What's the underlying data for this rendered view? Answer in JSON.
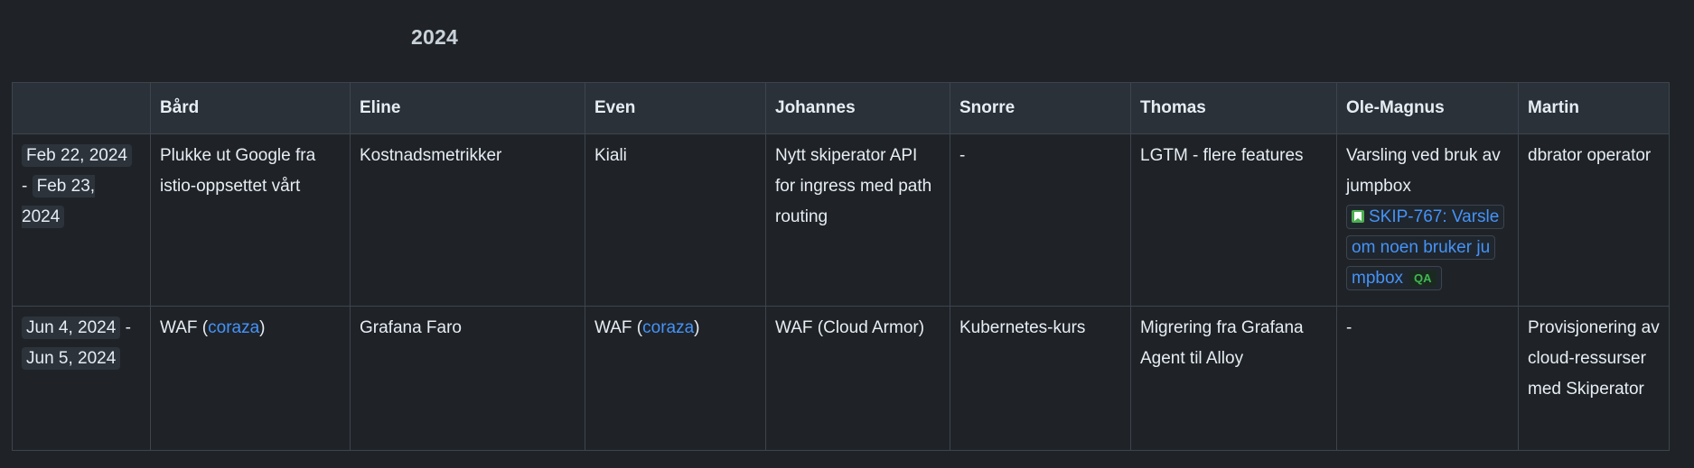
{
  "section_title": "2024",
  "table": {
    "headers": [
      "",
      "Bård",
      "Eline",
      "Even",
      "Johannes",
      "Snorre",
      "Thomas",
      "Ole-Magnus",
      "Martin"
    ],
    "rows": [
      {
        "date_start": "Feb 22, 2024",
        "date_sep": "-",
        "date_end": "Feb 23, 2024",
        "bard": "Plukke ut Google fra istio-oppsettet vårt",
        "eline": "Kostnadsmetrikker",
        "even": "Kiali",
        "johannes": "Nytt skiperator API for ingress med path routing",
        "snorre": "-",
        "thomas": "LGTM - flere features",
        "ole_magnus_text": "Varsling ved bruk av jumpbox",
        "ole_magnus_issue": "SKIP-767: Varsle om noen bruker jumpbox",
        "ole_magnus_issue_line1": "SKIP-767: Varsle",
        "ole_magnus_issue_line2": "om noen bruker ju",
        "ole_magnus_issue_line3": "mpbox",
        "ole_magnus_issue_status": "QA",
        "martin": "dbrator operator"
      },
      {
        "date_start": "Jun 4, 2024",
        "date_sep": "-",
        "date_end": "Jun 5, 2024",
        "bard_prefix": "WAF (",
        "bard_link": "coraza",
        "bard_suffix": ")",
        "eline": "Grafana Faro",
        "even_prefix": "WAF (",
        "even_link": "coraza",
        "even_suffix": ")",
        "johannes": "WAF (Cloud Armor)",
        "snorre": "Kubernetes-kurs",
        "thomas": "Migrering fra Grafana Agent til Alloy",
        "ole_magnus": "-",
        "martin": "Provisjonering av cloud-ressurser med Skiperator"
      }
    ]
  },
  "colors": {
    "background": "#1f2328",
    "header_bg": "#2b3138",
    "border": "#3d444d",
    "link": "#4493f8",
    "status_qa": "#3fb950",
    "jira_icon": "#4caf50"
  },
  "icons": {
    "issue_type": "story-bookmark-icon"
  }
}
